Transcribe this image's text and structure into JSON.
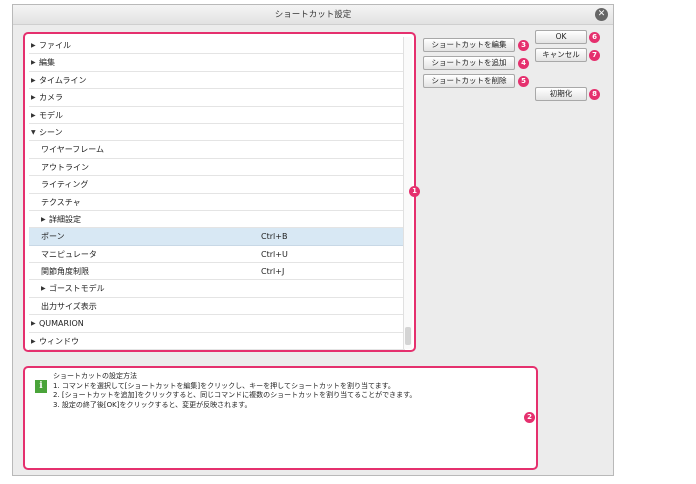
{
  "window": {
    "title": "ショートカット設定"
  },
  "tree": {
    "rows": [
      {
        "label": "ファイル",
        "level": 0,
        "arrow": "right",
        "shortcut": ""
      },
      {
        "label": "編集",
        "level": 0,
        "arrow": "right",
        "shortcut": ""
      },
      {
        "label": "タイムライン",
        "level": 0,
        "arrow": "right",
        "shortcut": ""
      },
      {
        "label": "カメラ",
        "level": 0,
        "arrow": "right",
        "shortcut": ""
      },
      {
        "label": "モデル",
        "level": 0,
        "arrow": "right",
        "shortcut": ""
      },
      {
        "label": "シーン",
        "level": 0,
        "arrow": "down",
        "shortcut": ""
      },
      {
        "label": "ワイヤーフレーム",
        "level": 1,
        "arrow": "",
        "shortcut": ""
      },
      {
        "label": "アウトライン",
        "level": 1,
        "arrow": "",
        "shortcut": ""
      },
      {
        "label": "ライティング",
        "level": 1,
        "arrow": "",
        "shortcut": ""
      },
      {
        "label": "テクスチャ",
        "level": 1,
        "arrow": "",
        "shortcut": ""
      },
      {
        "label": "詳細設定",
        "level": 1,
        "arrow": "right",
        "shortcut": ""
      },
      {
        "label": "ポーン",
        "level": 1,
        "arrow": "",
        "shortcut": "Ctrl+B",
        "selected": true
      },
      {
        "label": "マニピュレータ",
        "level": 1,
        "arrow": "",
        "shortcut": "Ctrl+U"
      },
      {
        "label": "関節角度制限",
        "level": 1,
        "arrow": "",
        "shortcut": "Ctrl+J"
      },
      {
        "label": "ゴーストモデル",
        "level": 1,
        "arrow": "right",
        "shortcut": ""
      },
      {
        "label": "出力サイズ表示",
        "level": 1,
        "arrow": "",
        "shortcut": ""
      },
      {
        "label": "QUMARION",
        "level": 0,
        "arrow": "right",
        "shortcut": ""
      },
      {
        "label": "ウィンドウ",
        "level": 0,
        "arrow": "right",
        "shortcut": ""
      }
    ]
  },
  "buttons": {
    "edit_shortcut": "ショートカットを編集",
    "add_shortcut": "ショートカットを追加",
    "delete_shortcut": "ショートカットを削除",
    "ok": "OK",
    "cancel": "キャンセル",
    "reset": "初期化"
  },
  "badges": {
    "b1": "1",
    "b2": "2",
    "b3": "3",
    "b4": "4",
    "b5": "5",
    "b6": "6",
    "b7": "7",
    "b8": "8"
  },
  "help": {
    "line1": "ショートカットの設定方法",
    "line2": "1. コマンドを選択して[ショートカットを編集]をクリックし、キーを押してショートカットを割り当てます。",
    "line3": "2. [ショートカットを追加]をクリックすると、同じコマンドに複数のショートカットを割り当てることができます。",
    "line4": "3. 設定の終了後[OK]をクリックすると、変更が反映されます。"
  },
  "colors": {
    "highlight": "#e5306e",
    "selected_row": "#d8e8f4",
    "info_icon": "#4aa43a"
  },
  "icons": {
    "close": "close-icon",
    "info": "info-icon",
    "expand": "triangle-right-icon",
    "collapse": "triangle-down-icon"
  }
}
